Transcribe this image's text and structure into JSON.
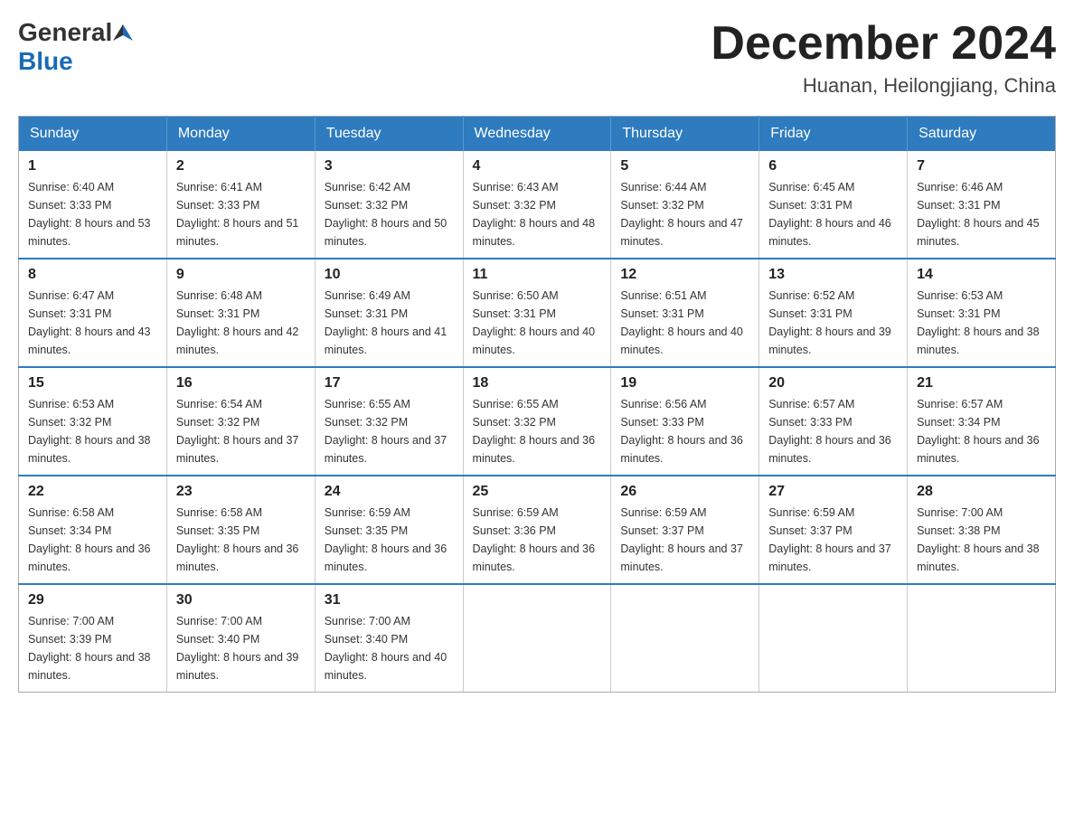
{
  "logo": {
    "general": "General",
    "blue": "Blue"
  },
  "header": {
    "title": "December 2024",
    "subtitle": "Huanan, Heilongjiang, China"
  },
  "weekdays": [
    "Sunday",
    "Monday",
    "Tuesday",
    "Wednesday",
    "Thursday",
    "Friday",
    "Saturday"
  ],
  "weeks": [
    [
      {
        "day": "1",
        "sunrise": "6:40 AM",
        "sunset": "3:33 PM",
        "daylight": "8 hours and 53 minutes."
      },
      {
        "day": "2",
        "sunrise": "6:41 AM",
        "sunset": "3:33 PM",
        "daylight": "8 hours and 51 minutes."
      },
      {
        "day": "3",
        "sunrise": "6:42 AM",
        "sunset": "3:32 PM",
        "daylight": "8 hours and 50 minutes."
      },
      {
        "day": "4",
        "sunrise": "6:43 AM",
        "sunset": "3:32 PM",
        "daylight": "8 hours and 48 minutes."
      },
      {
        "day": "5",
        "sunrise": "6:44 AM",
        "sunset": "3:32 PM",
        "daylight": "8 hours and 47 minutes."
      },
      {
        "day": "6",
        "sunrise": "6:45 AM",
        "sunset": "3:31 PM",
        "daylight": "8 hours and 46 minutes."
      },
      {
        "day": "7",
        "sunrise": "6:46 AM",
        "sunset": "3:31 PM",
        "daylight": "8 hours and 45 minutes."
      }
    ],
    [
      {
        "day": "8",
        "sunrise": "6:47 AM",
        "sunset": "3:31 PM",
        "daylight": "8 hours and 43 minutes."
      },
      {
        "day": "9",
        "sunrise": "6:48 AM",
        "sunset": "3:31 PM",
        "daylight": "8 hours and 42 minutes."
      },
      {
        "day": "10",
        "sunrise": "6:49 AM",
        "sunset": "3:31 PM",
        "daylight": "8 hours and 41 minutes."
      },
      {
        "day": "11",
        "sunrise": "6:50 AM",
        "sunset": "3:31 PM",
        "daylight": "8 hours and 40 minutes."
      },
      {
        "day": "12",
        "sunrise": "6:51 AM",
        "sunset": "3:31 PM",
        "daylight": "8 hours and 40 minutes."
      },
      {
        "day": "13",
        "sunrise": "6:52 AM",
        "sunset": "3:31 PM",
        "daylight": "8 hours and 39 minutes."
      },
      {
        "day": "14",
        "sunrise": "6:53 AM",
        "sunset": "3:31 PM",
        "daylight": "8 hours and 38 minutes."
      }
    ],
    [
      {
        "day": "15",
        "sunrise": "6:53 AM",
        "sunset": "3:32 PM",
        "daylight": "8 hours and 38 minutes."
      },
      {
        "day": "16",
        "sunrise": "6:54 AM",
        "sunset": "3:32 PM",
        "daylight": "8 hours and 37 minutes."
      },
      {
        "day": "17",
        "sunrise": "6:55 AM",
        "sunset": "3:32 PM",
        "daylight": "8 hours and 37 minutes."
      },
      {
        "day": "18",
        "sunrise": "6:55 AM",
        "sunset": "3:32 PM",
        "daylight": "8 hours and 36 minutes."
      },
      {
        "day": "19",
        "sunrise": "6:56 AM",
        "sunset": "3:33 PM",
        "daylight": "8 hours and 36 minutes."
      },
      {
        "day": "20",
        "sunrise": "6:57 AM",
        "sunset": "3:33 PM",
        "daylight": "8 hours and 36 minutes."
      },
      {
        "day": "21",
        "sunrise": "6:57 AM",
        "sunset": "3:34 PM",
        "daylight": "8 hours and 36 minutes."
      }
    ],
    [
      {
        "day": "22",
        "sunrise": "6:58 AM",
        "sunset": "3:34 PM",
        "daylight": "8 hours and 36 minutes."
      },
      {
        "day": "23",
        "sunrise": "6:58 AM",
        "sunset": "3:35 PM",
        "daylight": "8 hours and 36 minutes."
      },
      {
        "day": "24",
        "sunrise": "6:59 AM",
        "sunset": "3:35 PM",
        "daylight": "8 hours and 36 minutes."
      },
      {
        "day": "25",
        "sunrise": "6:59 AM",
        "sunset": "3:36 PM",
        "daylight": "8 hours and 36 minutes."
      },
      {
        "day": "26",
        "sunrise": "6:59 AM",
        "sunset": "3:37 PM",
        "daylight": "8 hours and 37 minutes."
      },
      {
        "day": "27",
        "sunrise": "6:59 AM",
        "sunset": "3:37 PM",
        "daylight": "8 hours and 37 minutes."
      },
      {
        "day": "28",
        "sunrise": "7:00 AM",
        "sunset": "3:38 PM",
        "daylight": "8 hours and 38 minutes."
      }
    ],
    [
      {
        "day": "29",
        "sunrise": "7:00 AM",
        "sunset": "3:39 PM",
        "daylight": "8 hours and 38 minutes."
      },
      {
        "day": "30",
        "sunrise": "7:00 AM",
        "sunset": "3:40 PM",
        "daylight": "8 hours and 39 minutes."
      },
      {
        "day": "31",
        "sunrise": "7:00 AM",
        "sunset": "3:40 PM",
        "daylight": "8 hours and 40 minutes."
      },
      null,
      null,
      null,
      null
    ]
  ],
  "labels": {
    "sunrise": "Sunrise: ",
    "sunset": "Sunset: ",
    "daylight": "Daylight: "
  }
}
